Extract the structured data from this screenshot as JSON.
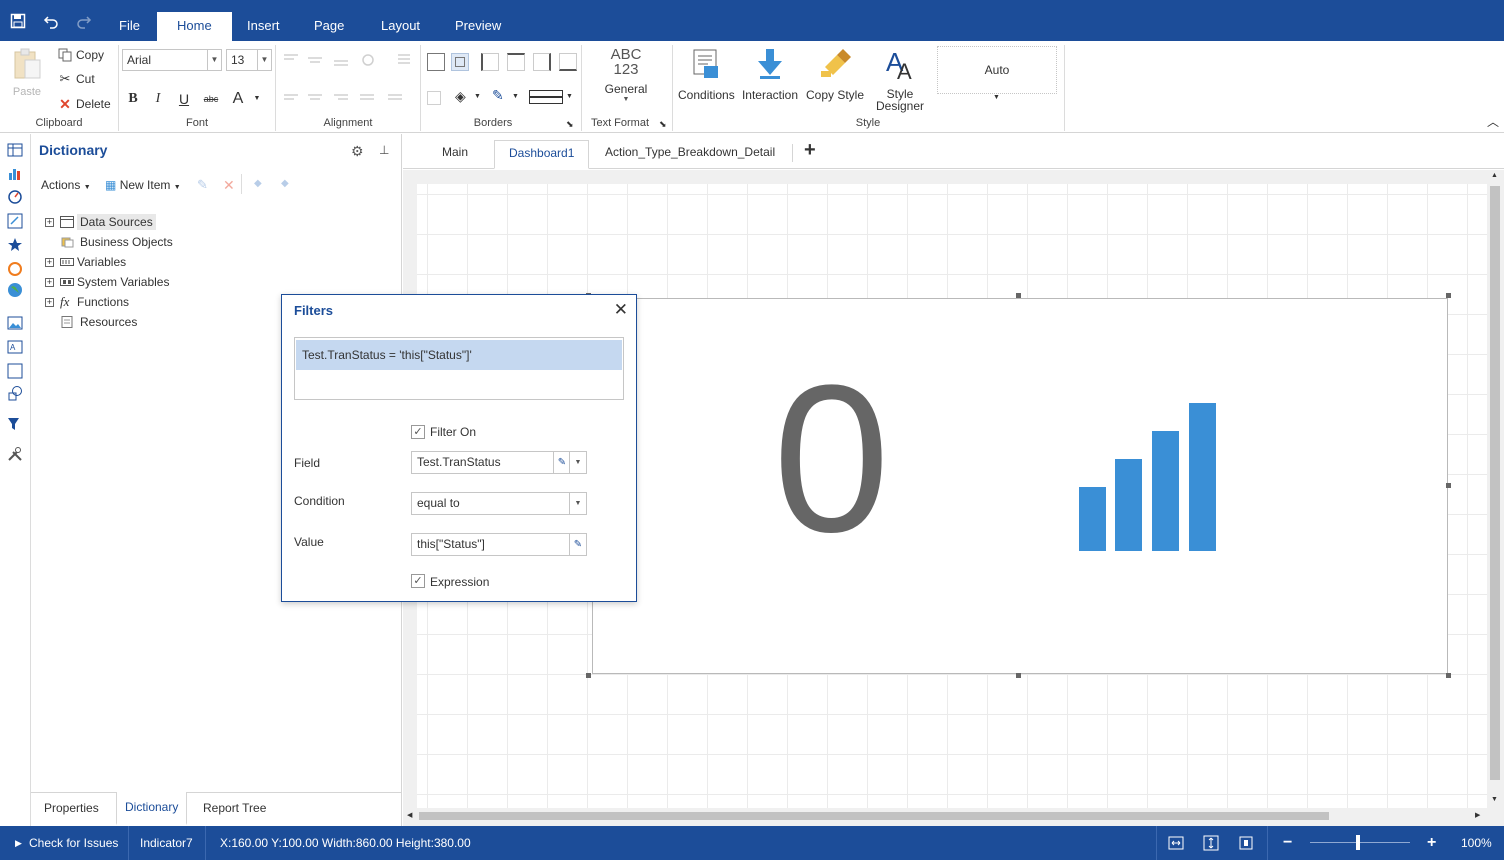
{
  "ribbon_tabs": [
    "File",
    "Home",
    "Insert",
    "Page",
    "Layout",
    "Preview"
  ],
  "clipboard": {
    "paste": "Paste",
    "copy": "Copy",
    "cut": "Cut",
    "delete": "Delete",
    "label": "Clipboard"
  },
  "font": {
    "family": "Arial",
    "size": "13",
    "label": "Font"
  },
  "alignment": {
    "label": "Alignment"
  },
  "borders": {
    "label": "Borders"
  },
  "text_format": {
    "icon_text_1": "ABC",
    "icon_text_2": "123",
    "value": "General",
    "label": "Text Format"
  },
  "style": {
    "conditions": "Conditions",
    "interaction": "Interaction",
    "copy_style": "Copy Style",
    "style_designer_1": "Style",
    "style_designer_2": "Designer",
    "auto": "Auto",
    "label": "Style"
  },
  "dictionary": {
    "title": "Dictionary",
    "actions": "Actions",
    "new_item": "New Item",
    "tree": [
      "Data Sources",
      "Business Objects",
      "Variables",
      "System Variables",
      "Functions",
      "Resources"
    ]
  },
  "bottom_tabs": [
    "Properties",
    "Dictionary",
    "Report Tree"
  ],
  "doc_tabs": [
    "Main",
    "Dashboard1",
    "Action_Type_Breakdown_Detail"
  ],
  "indicator": {
    "value": "0"
  },
  "filters": {
    "title": "Filters",
    "item": "Test.TranStatus = 'this[\"Status\"]'",
    "filter_on": "Filter On",
    "field_label": "Field",
    "field_value": "Test.TranStatus",
    "condition_label": "Condition",
    "condition_value": "equal to",
    "value_label": "Value",
    "value_value": "this[\"Status\"]",
    "expression": "Expression"
  },
  "status": {
    "check": "Check for Issues",
    "component": "Indicator7",
    "geometry": "X:160.00 Y:100.00 Width:860.00 Height:380.00",
    "zoom": "100%",
    "zoom_level": 1.0
  },
  "colors": {
    "brand": "#1c4d99",
    "accent": "#3a8fd6",
    "selection": "#c5d8f0"
  }
}
